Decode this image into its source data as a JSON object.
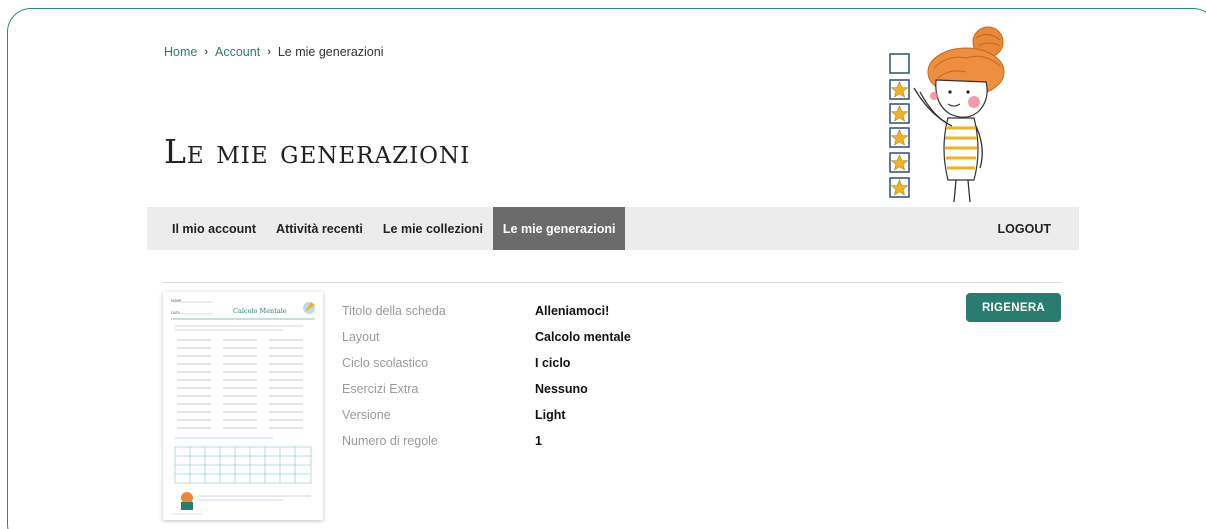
{
  "breadcrumb": {
    "home": "Home",
    "account": "Account",
    "current": "Le mie generazioni",
    "separator": "›"
  },
  "page": {
    "title": "Le mie generazioni"
  },
  "nav": {
    "items": [
      {
        "label": "Il mio account",
        "active": false
      },
      {
        "label": "Attività recenti",
        "active": false
      },
      {
        "label": "Le mie collezioni",
        "active": false
      },
      {
        "label": "Le mie generazioni",
        "active": true
      }
    ],
    "logout": "LOGOUT"
  },
  "generation": {
    "thumbnail": {
      "title": "Calcolo Mentale",
      "name_label": "NOME",
      "date_label": "DATA"
    },
    "details": [
      {
        "label": "Titolo della scheda",
        "value": "Alleniamoci!"
      },
      {
        "label": "Layout",
        "value": "Calcolo mentale"
      },
      {
        "label": "Ciclo scolastico",
        "value": "I ciclo"
      },
      {
        "label": "Esercizi Extra",
        "value": "Nessuno"
      },
      {
        "label": "Versione",
        "value": "Light"
      },
      {
        "label": "Numero di regole",
        "value": "1"
      }
    ],
    "regenerate_label": "RIGENERA"
  },
  "colors": {
    "accent": "#2a7c6e",
    "frame": "#2e8a78",
    "nav_active": "#6b6b6b",
    "nav_bg": "#ececec"
  }
}
